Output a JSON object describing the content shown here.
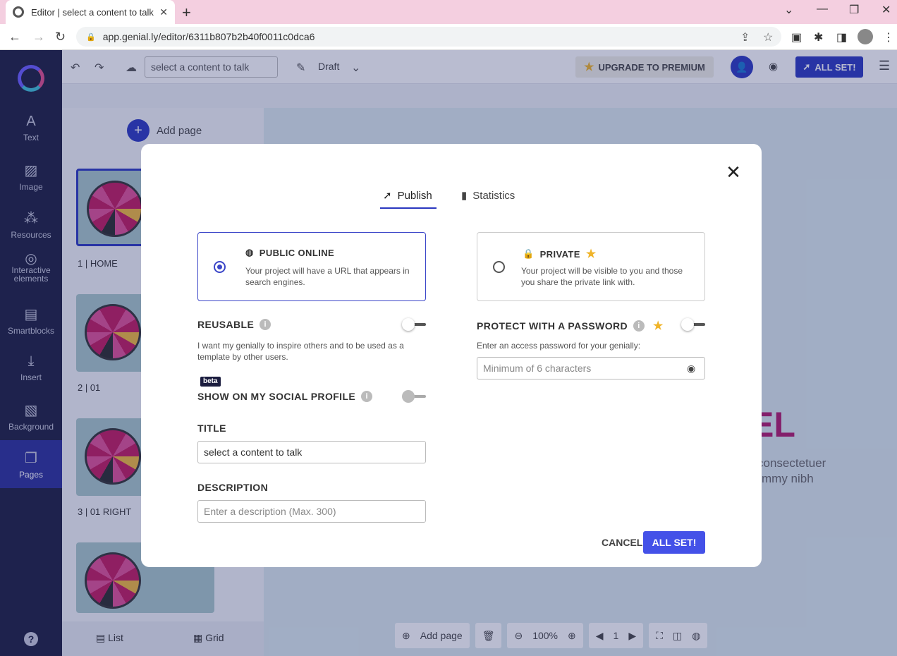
{
  "browser": {
    "tab_title": "Editor | select a content to talk",
    "url": "app.genial.ly/editor/6311b807b2b40f0011c0dca6"
  },
  "leftbar": {
    "items": [
      {
        "label": "Text",
        "icon": "text-icon"
      },
      {
        "label": "Image",
        "icon": "image-icon"
      },
      {
        "label": "Resources",
        "icon": "resources-icon"
      },
      {
        "label": "Interactive elements",
        "icon": "interactive-icon"
      },
      {
        "label": "Smartblocks",
        "icon": "smartblocks-icon"
      },
      {
        "label": "Insert",
        "icon": "insert-icon"
      },
      {
        "label": "Background",
        "icon": "background-icon"
      },
      {
        "label": "Pages",
        "icon": "pages-icon"
      }
    ],
    "help": "?"
  },
  "topbar": {
    "title_value": "select a content to talk",
    "draft_label": "Draft",
    "upgrade_label": "UPGRADE TO PREMIUM",
    "allset_label": "ALL SET!"
  },
  "pages": {
    "add_page_label": "Add page",
    "items": [
      {
        "label": "1 |  HOME"
      },
      {
        "label": "2 |  01"
      },
      {
        "label": "3 |  01 RIGHT"
      }
    ],
    "list_label": "List",
    "grid_label": "Grid"
  },
  "canvas": {
    "heading_fragment": "EL",
    "body_line1": "consectetuer",
    "body_line2": "mmy nibh"
  },
  "bottombar": {
    "add_page_label": "Add page",
    "zoom": "100%",
    "page_number": "1"
  },
  "modal": {
    "tab_publish": "Publish",
    "tab_statistics": "Statistics",
    "public": {
      "title": "PUBLIC ONLINE",
      "desc": "Your project will have a URL that appears in search engines."
    },
    "private": {
      "title": "PRIVATE",
      "desc": "Your project will be visible to you and those you share the private link with."
    },
    "reusable_label": "REUSABLE",
    "reusable_help": "I want my genially to inspire others and to be used as a template by other users.",
    "beta_label": "beta",
    "social_label": "SHOW ON MY SOCIAL PROFILE",
    "title_label": "TITLE",
    "title_value": "select a content to talk",
    "description_label": "DESCRIPTION",
    "description_placeholder": "Enter a description (Max. 300)",
    "password_label": "PROTECT WITH A PASSWORD",
    "password_help": "Enter an access password for your genially:",
    "password_placeholder": "Minimum of 6 characters",
    "cancel_label": "CANCEL",
    "allset_label": "ALL SET!"
  },
  "colors": {
    "brand_blue": "#2a37c0",
    "button_blue": "#4451e8",
    "sidebar_bg": "#1b1d3f",
    "premium_star": "#f0b429"
  }
}
